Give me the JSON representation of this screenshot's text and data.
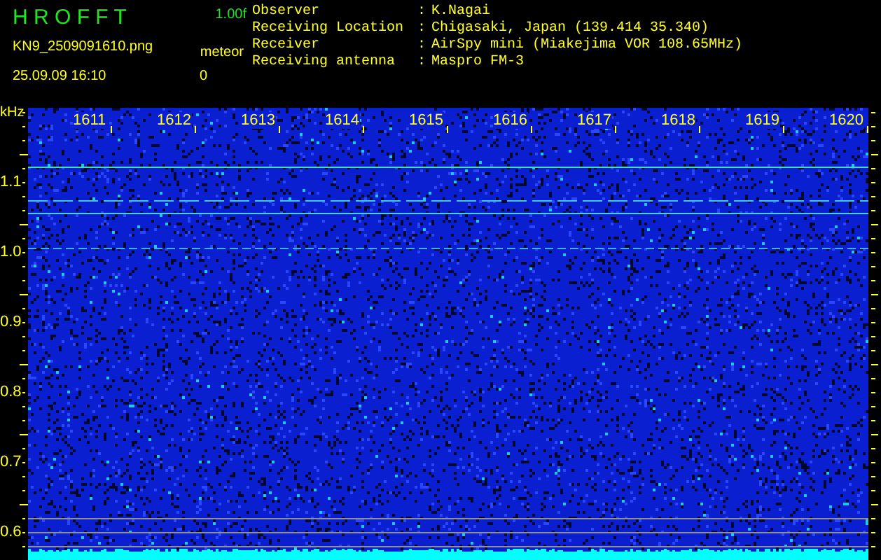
{
  "app": {
    "title": "H R O F F T",
    "version": "1.00f"
  },
  "file": {
    "name": "KN9_2509091610.png",
    "timestamp": "25.09.09 16:10"
  },
  "counter": {
    "label": "meteor",
    "value": "0"
  },
  "station_info": [
    {
      "label": "Observer",
      "separator": ":",
      "value": "K.Nagai"
    },
    {
      "label": "Receiving Location",
      "separator": ":",
      "value": "Chigasaki, Japan (139.414 35.340)"
    },
    {
      "label": "Receiver",
      "separator": ":",
      "value": "AirSpy mini (Miakejima VOR 108.65MHz)"
    },
    {
      "label": "Receiving antenna",
      "separator": ":",
      "value": "Maspro FM-3"
    }
  ],
  "frequency_axis": {
    "unit": "kHz",
    "labels": [
      "1.1",
      "1.0",
      "0.9",
      "0.8",
      "0.7",
      "0.6"
    ]
  },
  "time_axis": {
    "labels": [
      "1611",
      "1612",
      "1613",
      "1614",
      "1615",
      "1616",
      "1617",
      "1618",
      "1619",
      "1620"
    ]
  }
}
